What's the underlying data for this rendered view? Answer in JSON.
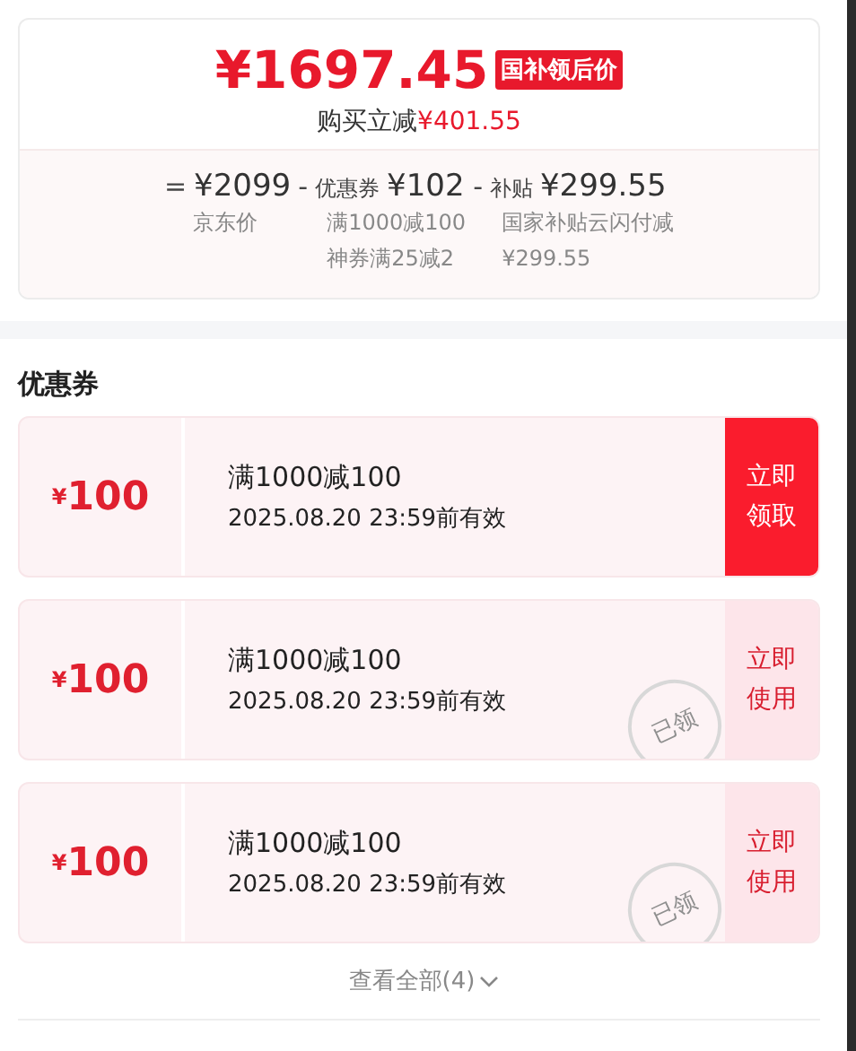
{
  "price_card": {
    "price": "¥1697.45",
    "badge": "国补领后价",
    "discount": {
      "label": "购买立减",
      "amount": "¥401.55"
    },
    "breakdown": [
      {
        "operator": "=",
        "value": "¥2099",
        "notes": [
          "京东价"
        ]
      },
      {
        "operator": "-",
        "label": "优惠券",
        "value": "¥102",
        "notes": [
          "满1000减100",
          "神券满25减2"
        ]
      },
      {
        "operator": "-",
        "label": "补贴",
        "value": "¥299.55",
        "notes": [
          "国家补贴云闪付减¥299.55"
        ]
      }
    ]
  },
  "coupons": {
    "title": "优惠券",
    "items": [
      {
        "currency": "¥",
        "amount": "100",
        "condition": "满1000减100",
        "validity": "2025.08.20 23:59前有效",
        "button": "立即领取",
        "claimed": false
      },
      {
        "currency": "¥",
        "amount": "100",
        "condition": "满1000减100",
        "validity": "2025.08.20 23:59前有效",
        "button": "立即使用",
        "claimed": true,
        "stamp": "已领"
      },
      {
        "currency": "¥",
        "amount": "100",
        "condition": "满1000减100",
        "validity": "2025.08.20 23:59前有效",
        "button": "立即使用",
        "claimed": true,
        "stamp": "已领"
      }
    ],
    "view_all": "查看全部(4)"
  }
}
